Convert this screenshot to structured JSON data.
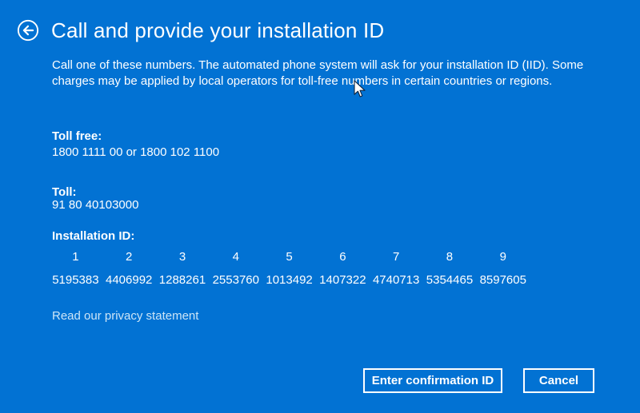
{
  "colors": {
    "background": "#0272d3",
    "text": "#ffffff",
    "link": "#cde5f7"
  },
  "header": {
    "title": "Call and provide your installation ID"
  },
  "intro_lines": [
    "Call one of these numbers. The automated phone system will ask for your installation ID (IID). Some",
    "charges may be applied by local operators for toll-free numbers in certain countries or regions."
  ],
  "toll_free": {
    "label": "Toll free:",
    "value": "1800 1111 00 or 1800 102 1100"
  },
  "toll": {
    "label": "Toll:",
    "value": "91 80 40103000"
  },
  "installation_id": {
    "label": "Installation ID:",
    "columns": [
      "1",
      "2",
      "3",
      "4",
      "5",
      "6",
      "7",
      "8",
      "9"
    ],
    "values": [
      "5195383",
      "4406992",
      "1288261",
      "2553760",
      "1013492",
      "1407322",
      "4740713",
      "5354465",
      "8597605"
    ]
  },
  "privacy_link_label": "Read our privacy statement",
  "buttons": {
    "confirm_label": "Enter confirmation ID",
    "cancel_label": "Cancel"
  }
}
